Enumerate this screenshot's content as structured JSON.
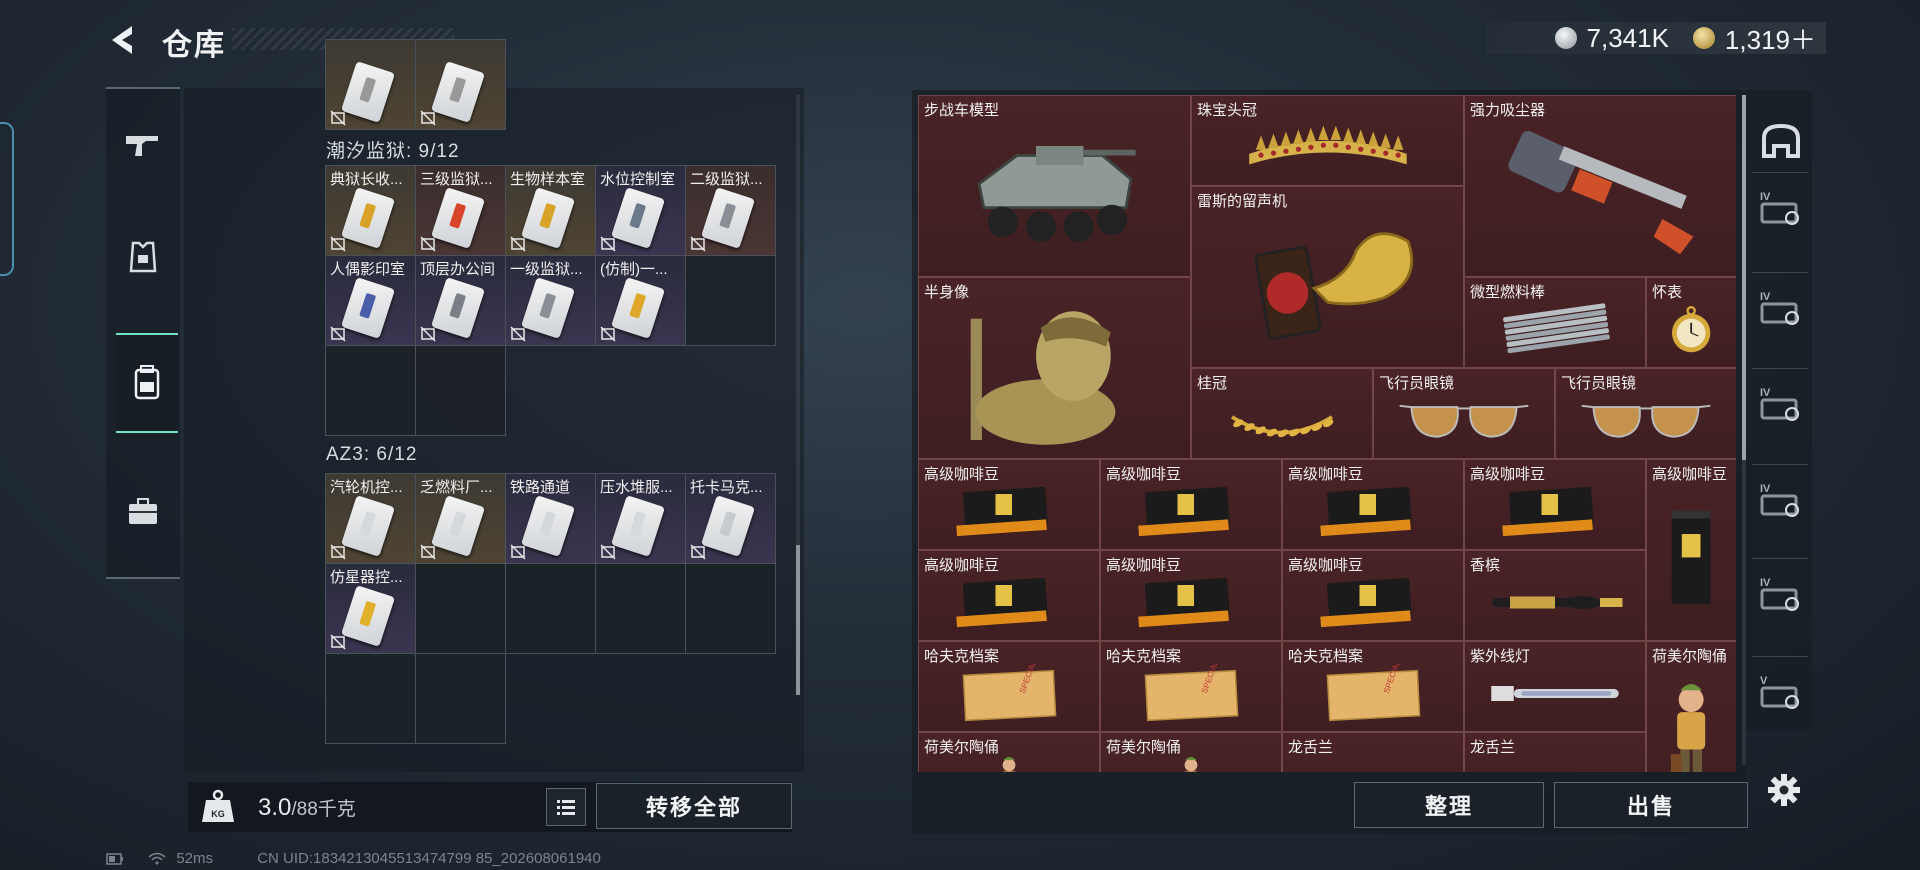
{
  "header": {
    "title": "仓库",
    "currencies": [
      {
        "icon": "silver-coin-icon",
        "value": "7,341K",
        "color": "#c9ced4"
      },
      {
        "icon": "gold-coin-icon",
        "value": "1,319＋",
        "color": "#c9a64a"
      }
    ]
  },
  "left_nav": {
    "items": [
      {
        "icon": "gun-icon",
        "active": false
      },
      {
        "icon": "armor-icon",
        "active": false
      },
      {
        "icon": "backpack-icon",
        "active": true
      },
      {
        "icon": "briefcase-icon",
        "active": false
      }
    ],
    "accent": "#6fe3c0"
  },
  "keys": {
    "sections": [
      {
        "label": "潮汐监狱: 9/12",
        "items": [
          {
            "name": "典狱长收...",
            "tone": "gold",
            "stripe": "#d9a32a"
          },
          {
            "name": "三级监狱...",
            "tone": "red",
            "stripe": "#d8442a"
          },
          {
            "name": "生物样本室",
            "tone": "gold",
            "stripe": "#d9a32a"
          },
          {
            "name": "水位控制室",
            "tone": "purple",
            "stripe": "#6a7a8a"
          },
          {
            "name": "二级监狱...",
            "tone": "red",
            "stripe": "#8a8f96"
          },
          {
            "name": "人偶影印室",
            "tone": "purple",
            "stripe": "#4b5da8"
          },
          {
            "name": "顶层办公间",
            "tone": "purple",
            "stripe": "#7a7f86"
          },
          {
            "name": "一级监狱...",
            "tone": "purple",
            "stripe": "#8a8f96"
          },
          {
            "name": "(仿制)一...",
            "tone": "purple",
            "stripe": "#e0a82a"
          }
        ],
        "rows": 3
      },
      {
        "label": "AZ3: 6/12",
        "items": [
          {
            "name": "汽轮机控...",
            "tone": "gold",
            "stripe": "#d5d8dc"
          },
          {
            "name": "乏燃料厂...",
            "tone": "gold",
            "stripe": "#d5d8dc"
          },
          {
            "name": "铁路通道",
            "tone": "purple",
            "stripe": "#d5d8dc"
          },
          {
            "name": "压水堆服...",
            "tone": "purple",
            "stripe": "#d5d8dc"
          },
          {
            "name": "托卡马克...",
            "tone": "purple",
            "stripe": "#c7cbd0"
          },
          {
            "name": "仿星器控...",
            "tone": "purple",
            "stripe": "#e0b02a"
          }
        ],
        "rows": 3
      }
    ]
  },
  "capacity": {
    "current": "3.0",
    "max": "/88千克"
  },
  "buttons": {
    "transfer_all": "转移全部",
    "sort": "整理",
    "sell": "出售"
  },
  "status": {
    "ping": "52ms",
    "uid": "CN UID:1834213045513474799 85_202608061940"
  },
  "stash": {
    "items": [
      {
        "name": "步战车模型",
        "icon": "ifv-model-icon"
      },
      {
        "name": "珠宝头冠",
        "icon": "jeweled-tiara-icon"
      },
      {
        "name": "强力吸尘器",
        "icon": "vacuum-cleaner-icon"
      },
      {
        "name": "雷斯的留声机",
        "icon": "gramophone-icon"
      },
      {
        "name": "半身像",
        "icon": "bust-statue-icon"
      },
      {
        "name": "微型燃料棒",
        "icon": "fuel-rods-icon"
      },
      {
        "name": "怀表",
        "icon": "pocket-watch-icon"
      },
      {
        "name": "桂冠",
        "icon": "laurel-wreath-icon"
      },
      {
        "name": "飞行员眼镜",
        "icon": "aviator-glasses-icon"
      },
      {
        "name": "飞行员眼镜",
        "icon": "aviator-glasses-icon"
      },
      {
        "name": "高级咖啡豆",
        "icon": "coffee-bag-icon"
      },
      {
        "name": "高级咖啡豆",
        "icon": "coffee-bag-icon"
      },
      {
        "name": "高级咖啡豆",
        "icon": "coffee-bag-icon"
      },
      {
        "name": "高级咖啡豆",
        "icon": "coffee-bag-icon"
      },
      {
        "name": "高级咖啡豆",
        "icon": "coffee-bag-tall-icon"
      },
      {
        "name": "高级咖啡豆",
        "icon": "coffee-bag-icon"
      },
      {
        "name": "高级咖啡豆",
        "icon": "coffee-bag-icon"
      },
      {
        "name": "高级咖啡豆",
        "icon": "coffee-bag-icon"
      },
      {
        "name": "香槟",
        "icon": "champagne-icon"
      },
      {
        "name": "哈夫克档案",
        "icon": "dossier-icon"
      },
      {
        "name": "哈夫克档案",
        "icon": "dossier-icon"
      },
      {
        "name": "哈夫克档案",
        "icon": "dossier-icon"
      },
      {
        "name": "紫外线灯",
        "icon": "uv-lamp-icon"
      },
      {
        "name": "荷美尔陶俑",
        "icon": "figurine-icon"
      },
      {
        "name": "荷美尔陶俑",
        "icon": "figurine-icon"
      },
      {
        "name": "荷美尔陶俑",
        "icon": "figurine-icon"
      },
      {
        "name": "龙舌兰",
        "icon": "tequila-icon"
      },
      {
        "name": "龙舌兰",
        "icon": "tequila-icon"
      }
    ]
  },
  "right_tabs": [
    "helmet-case-icon",
    "level4-armor-icon",
    "level4-rig-icon",
    "level4-gun-icon",
    "level4-hand-icon",
    "level4-ammo-icon",
    "level5-ammo-icon"
  ]
}
